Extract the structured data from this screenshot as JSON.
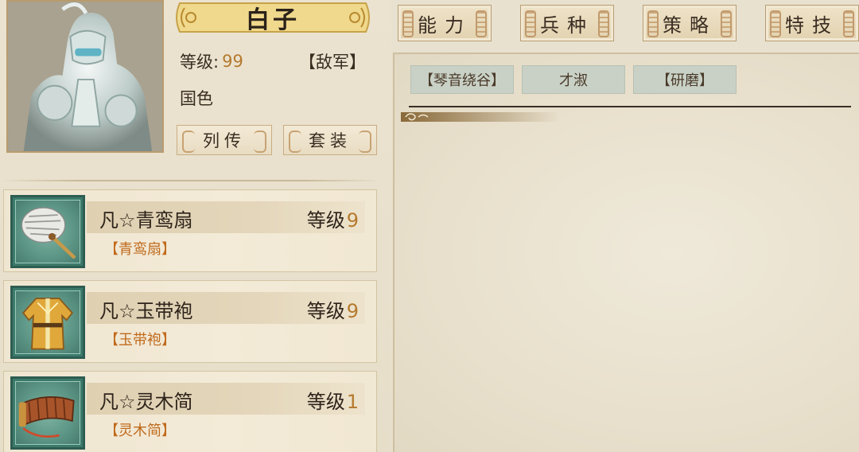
{
  "hero": {
    "name": "白子",
    "level_label": "等级:",
    "level_value": "99",
    "faction": "【敌军】",
    "trait": "国色"
  },
  "buttons": {
    "biography": "列传",
    "set": "套装"
  },
  "equipment": [
    {
      "name": "凡☆青鸾扇",
      "level_label": "等级",
      "level": "9",
      "tag": "【青鸾扇】",
      "icon": "feather-fan-icon"
    },
    {
      "name": "凡☆玉带袍",
      "level_label": "等级",
      "level": "9",
      "tag": "【玉带袍】",
      "icon": "robe-icon"
    },
    {
      "name": "凡☆灵木简",
      "level_label": "等级",
      "level": "1",
      "tag": "【灵木简】",
      "icon": "bamboo-scroll-icon"
    }
  ],
  "tabs": [
    {
      "label": "能力"
    },
    {
      "label": "兵种"
    },
    {
      "label": "策略"
    },
    {
      "label": "特技"
    }
  ],
  "traits": [
    "【琴音绕谷】",
    "才淑",
    "【研磨】"
  ],
  "colors": {
    "accent": "#b57a2e",
    "tag": "#c06a1c",
    "icon_frame": "#3c7a6a",
    "trait_bg": "#c9d1c6"
  }
}
